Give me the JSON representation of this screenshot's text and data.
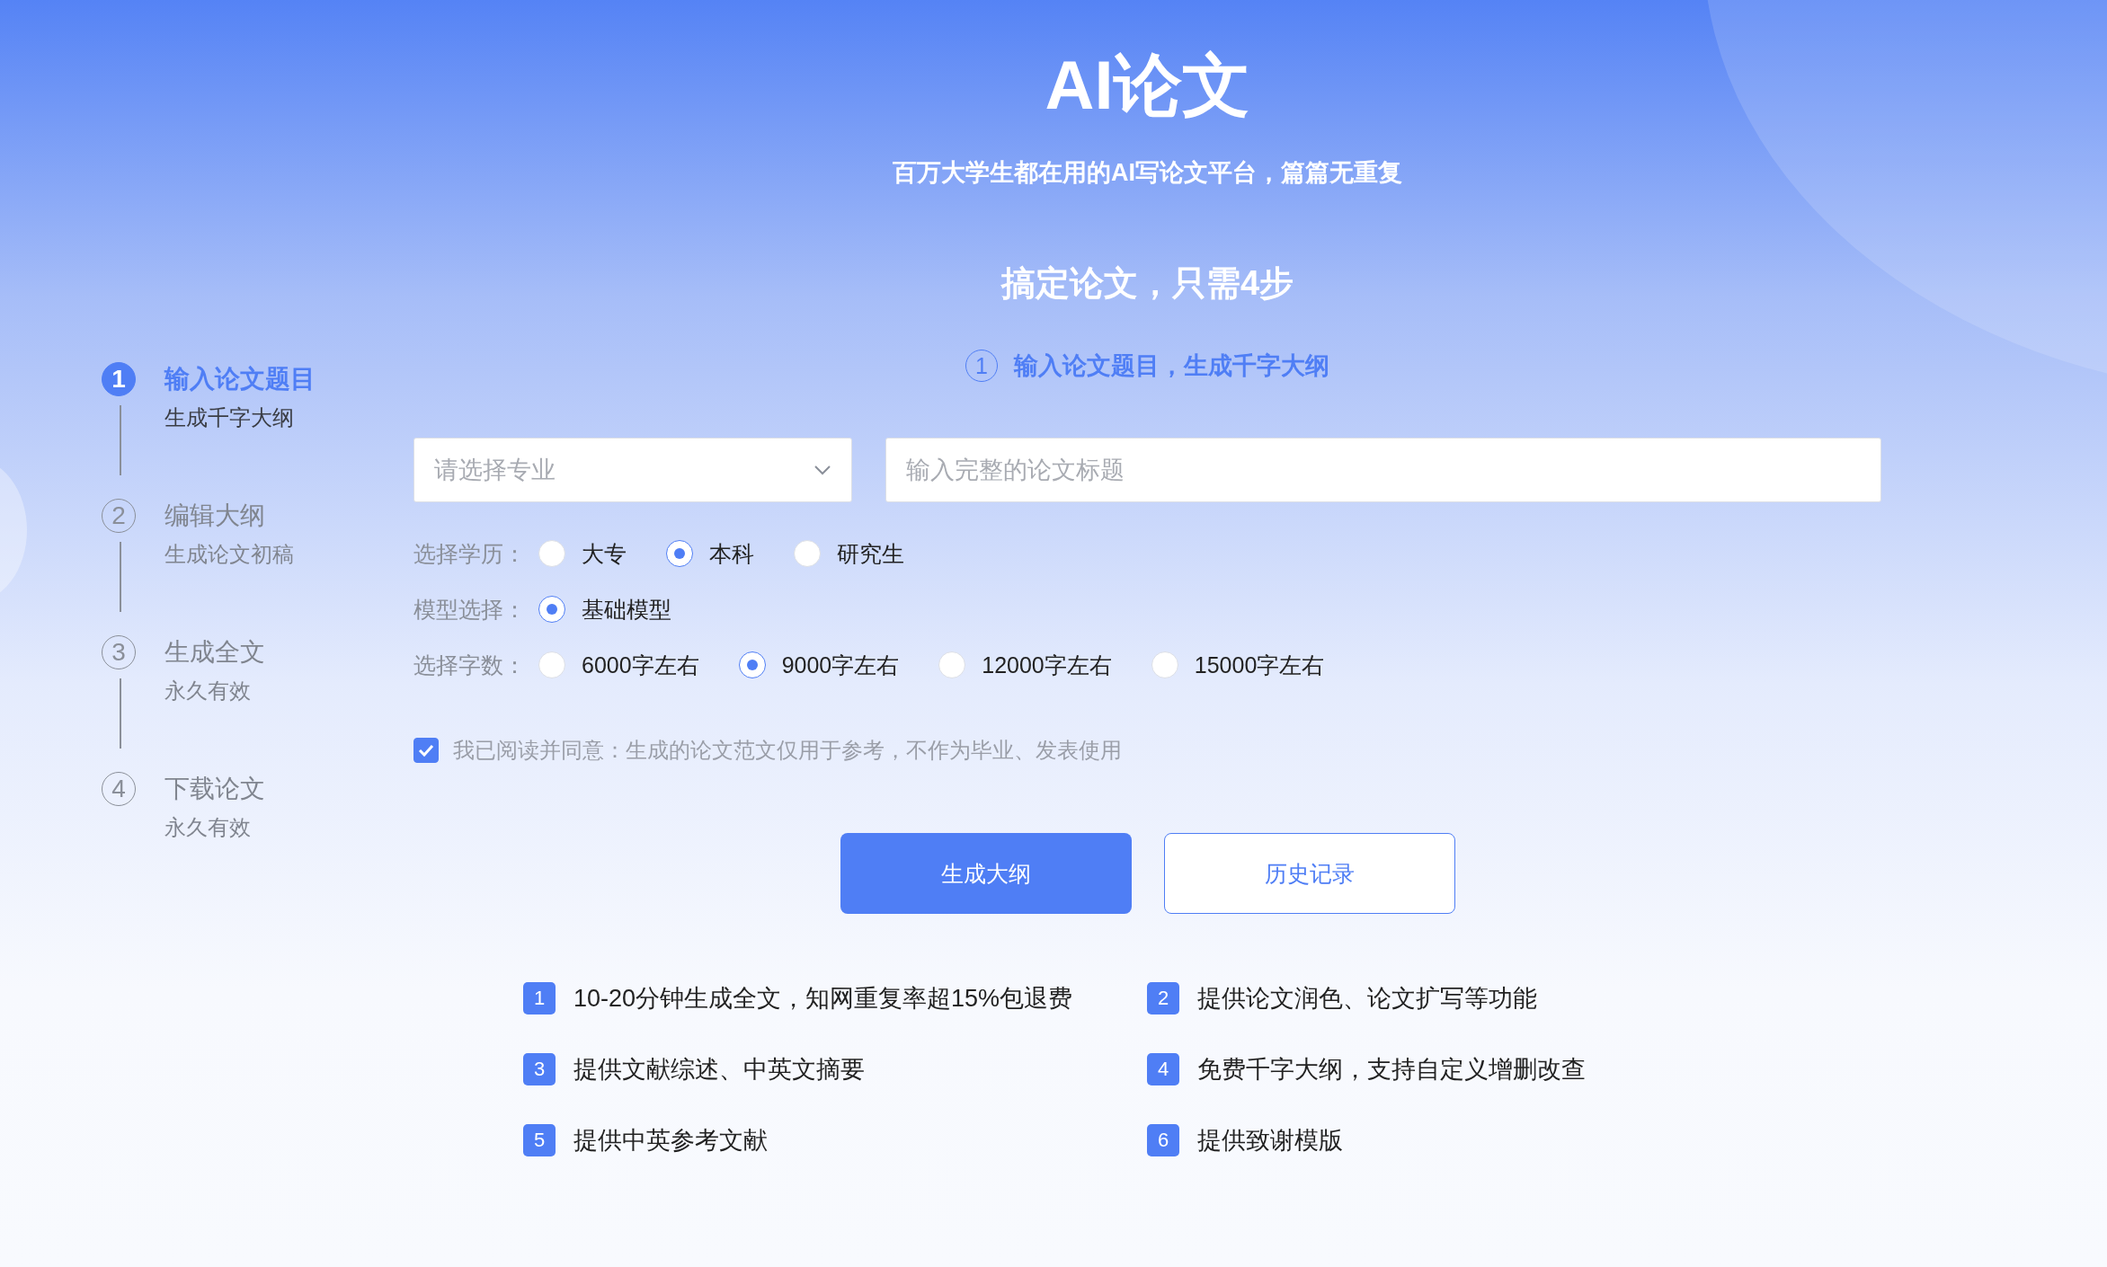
{
  "header": {
    "title": "AI论文",
    "subtitle": "百万大学生都在用的AI写论文平台，篇篇无重复"
  },
  "steps": [
    {
      "number": "1",
      "title": "输入论文题目",
      "caption": "生成千字大纲",
      "selected": true
    },
    {
      "number": "2",
      "title": "编辑大纲",
      "caption": "生成论文初稿",
      "selected": false
    },
    {
      "number": "3",
      "title": "生成全文",
      "caption": "永久有效",
      "selected": false
    },
    {
      "number": "4",
      "title": "下载论文",
      "caption": "永久有效",
      "selected": false
    }
  ],
  "main": {
    "heading": "搞定论文，只需4步",
    "current_step": {
      "number": "1",
      "text": "输入论文题目，生成千字大纲"
    },
    "major_select": {
      "placeholder": "请选择专业"
    },
    "title_input": {
      "placeholder": "输入完整的论文标题"
    },
    "option_groups": [
      {
        "label": "选择学历：",
        "options": [
          {
            "label": "大专",
            "selected": false
          },
          {
            "label": "本科",
            "selected": true
          },
          {
            "label": "研究生",
            "selected": false
          }
        ]
      },
      {
        "label": "模型选择：",
        "options": [
          {
            "label": "基础模型",
            "selected": true
          }
        ]
      },
      {
        "label": "选择字数：",
        "options": [
          {
            "label": "6000字左右",
            "selected": false
          },
          {
            "label": "9000字左右",
            "selected": true
          },
          {
            "label": "12000字左右",
            "selected": false
          },
          {
            "label": "15000字左右",
            "selected": false
          }
        ]
      }
    ],
    "agreement": {
      "text": "我已阅读并同意：生成的论文范文仅用于参考，不作为毕业、发表使用",
      "checked": true
    },
    "buttons": [
      {
        "label": "生成大纲",
        "kind": "primary"
      },
      {
        "label": "历史记录",
        "kind": "secondary"
      }
    ],
    "features": [
      {
        "number": "1",
        "text": "10-20分钟生成全文，知网重复率超15%包退费"
      },
      {
        "number": "2",
        "text": "提供论文润色、论文扩写等功能"
      },
      {
        "number": "3",
        "text": "提供文献综述、中英文摘要"
      },
      {
        "number": "4",
        "text": "免费千字大纲，支持自定义增删改查"
      },
      {
        "number": "5",
        "text": "提供中英参考文献"
      },
      {
        "number": "6",
        "text": "提供致谢模版"
      }
    ]
  }
}
